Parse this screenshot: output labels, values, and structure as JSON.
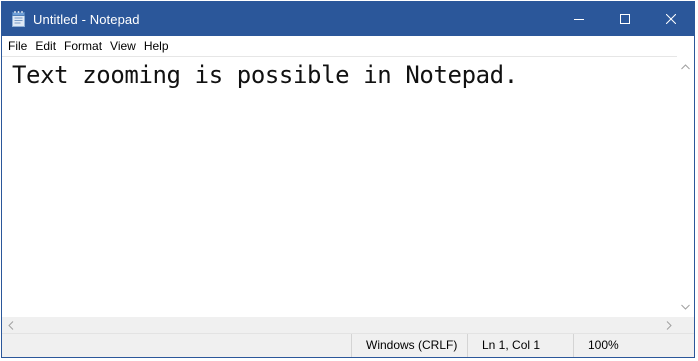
{
  "window": {
    "title": "Untitled - Notepad",
    "accent_color": "#2b579a",
    "app_icon": "notepad-icon",
    "caption_buttons": [
      "minimize-icon",
      "maximize-icon",
      "close-icon"
    ]
  },
  "menu": {
    "items": [
      "File",
      "Edit",
      "Format",
      "View",
      "Help"
    ]
  },
  "editor": {
    "content": "Text zooming is possible in Notepad."
  },
  "statusbar": {
    "line_ending": "Windows (CRLF)",
    "cursor_position": "Ln 1, Col 1",
    "zoom": "100%"
  }
}
